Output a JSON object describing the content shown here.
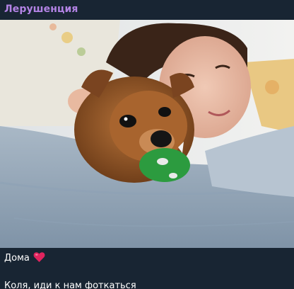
{
  "message": {
    "sender_name": "Лерушенция",
    "photo": {
      "description_icon": "photo-content",
      "kind": "photo"
    },
    "caption_line1": "Дома",
    "caption_emoji": "red-heart-icon",
    "caption_line2": "Коля, иди к нам фоткаться"
  },
  "colors": {
    "background": "#182533",
    "sender_name": "#b383e5",
    "text": "#ffffff",
    "heart": "#e0245e"
  }
}
